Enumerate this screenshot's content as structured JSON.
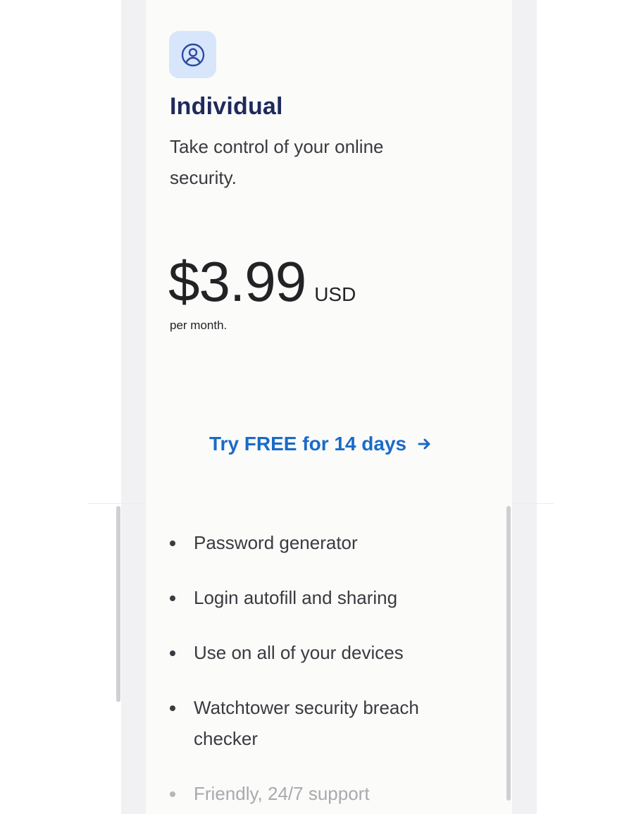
{
  "plan": {
    "icon": "user-circle-icon",
    "name": "Individual",
    "description": "Take control of your online security.",
    "price": {
      "amount": "$3.99",
      "currency": "USD",
      "period": "per month."
    },
    "cta_label": "Try FREE for 14 days",
    "features": [
      "Password generator",
      "Login autofill and sharing",
      "Use on all of your devices",
      "Watchtower security breach checker",
      "Friendly, 24/7 support"
    ]
  },
  "colors": {
    "title": "#1f2a5c",
    "accent": "#1a6bc8",
    "icon_bg": "#d8e6fb",
    "icon_stroke": "#2d4aa0",
    "card_bg": "#fbfbfa",
    "page_bg": "#f1f1f3"
  }
}
